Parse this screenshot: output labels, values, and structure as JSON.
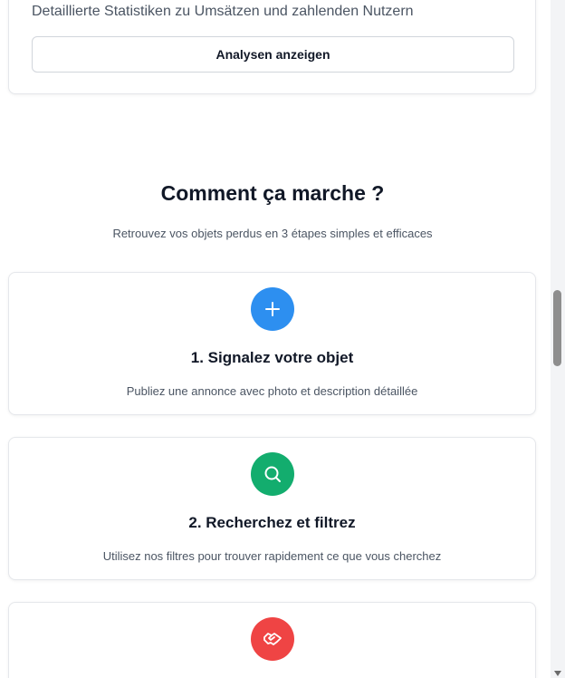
{
  "top_card": {
    "description": "Detaillierte Statistiken zu Umsätzen und zahlenden Nutzern",
    "button_label": "Analysen anzeigen"
  },
  "how_it_works": {
    "title": "Comment ça marche ?",
    "subtitle": "Retrouvez vos objets perdus en 3 étapes simples et efficaces",
    "steps": [
      {
        "icon": "plus-icon",
        "color": "#2d8ff0",
        "title": "1. Signalez votre objet",
        "description": "Publiez une annonce avec photo et description détaillée"
      },
      {
        "icon": "search-icon",
        "color": "#13ad6e",
        "title": "2. Recherchez et filtrez",
        "description": "Utilisez nos filtres pour trouver rapidement ce que vous cherchez"
      },
      {
        "icon": "handshake-icon",
        "color": "#ef4444",
        "title": "",
        "description": ""
      }
    ]
  }
}
